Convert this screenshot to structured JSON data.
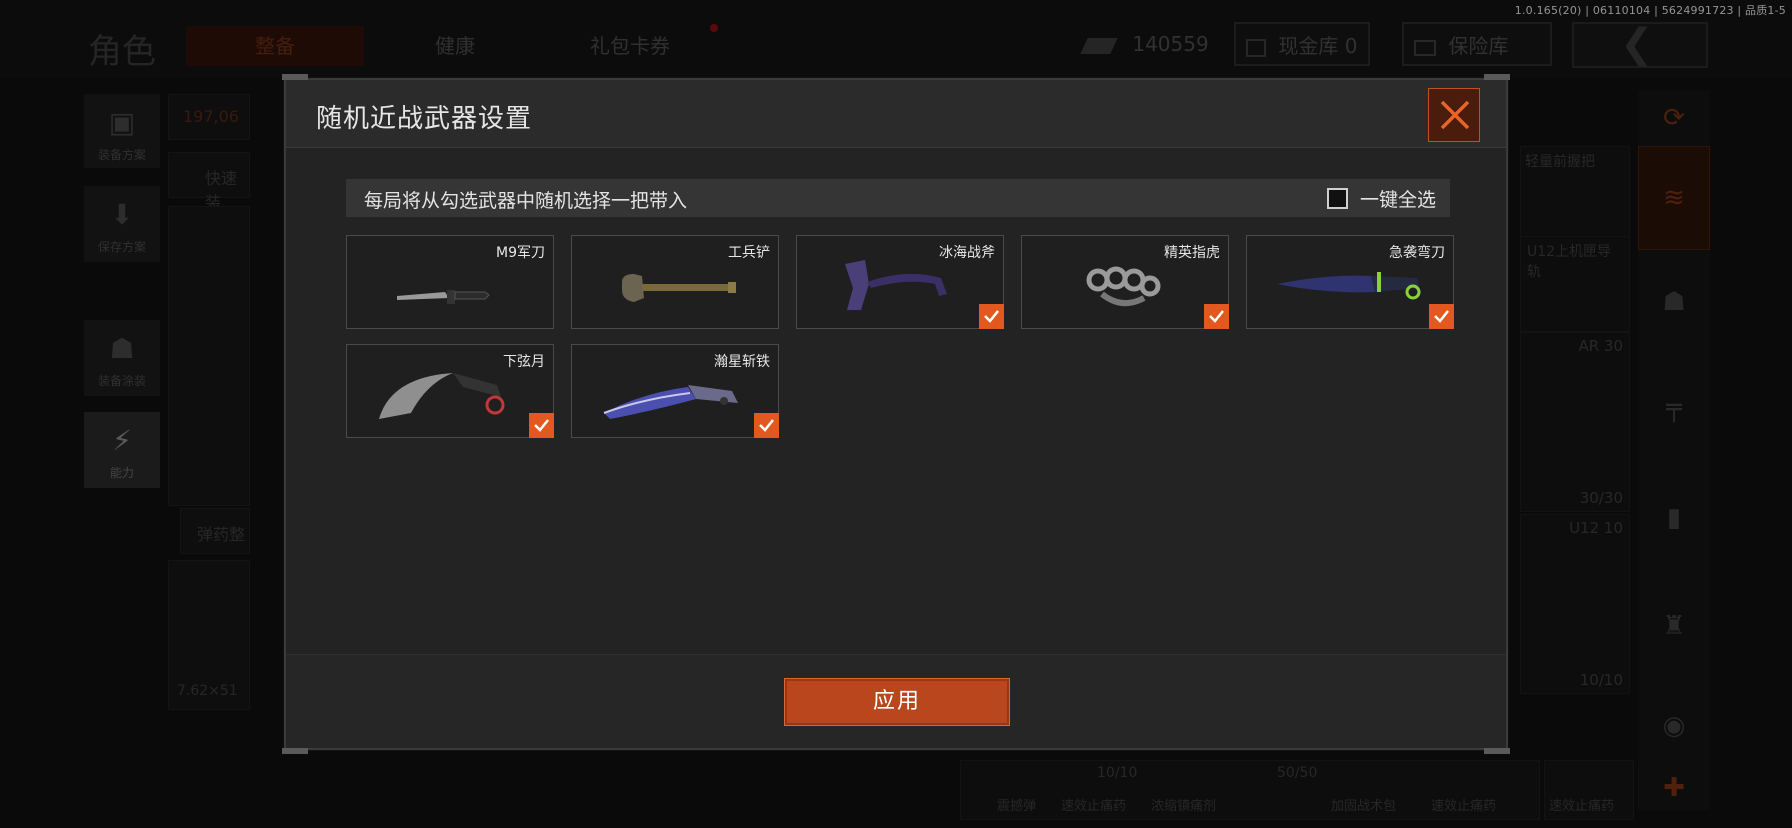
{
  "version_info": "1.0.165(20) | 06110104 | 5624991723 | 品质1-5",
  "background": {
    "page_title": "角色",
    "tabs": [
      {
        "label": "整备",
        "active": true
      },
      {
        "label": "健康",
        "active": false
      },
      {
        "label": "礼包卡券",
        "active": false
      }
    ],
    "currency_amount": "140559",
    "cash_vault_label": "现金库 0",
    "insurance_label": "保险库",
    "side_menu": [
      {
        "label": "装备方案"
      },
      {
        "label": "保存方案"
      },
      {
        "label": "装备涂装"
      },
      {
        "label": "能力"
      }
    ],
    "value_readout": "197,06",
    "quick_label": "快速装",
    "ammo_label": "弹药整",
    "caliber": "7.62×51",
    "right_slots": [
      {
        "label": "轻量前握把"
      },
      {
        "label": "U12上机匣导轨"
      },
      {
        "label": "AR 30",
        "count": "30/30"
      },
      {
        "label": "U12 10",
        "count": "10/10"
      }
    ],
    "bottom_counts": [
      "10/10",
      "50/50"
    ],
    "bottom_items": [
      "震撼弹",
      "速效止痛药",
      "浓缩镇痛剂",
      "加固战术包",
      "速效止痛药",
      "速效止痛药"
    ]
  },
  "modal": {
    "title": "随机近战武器设置",
    "info_text": "每局将从勾选武器中随机选择一把带入",
    "select_all_label": "一键全选",
    "apply_label": "应用",
    "accent_color": "#e2581f",
    "weapons": [
      {
        "name": "M9军刀",
        "checked": false,
        "icon": "bayonet-icon"
      },
      {
        "name": "工兵铲",
        "checked": false,
        "icon": "shovel-icon"
      },
      {
        "name": "冰海战斧",
        "checked": true,
        "icon": "axe-icon"
      },
      {
        "name": "精英指虎",
        "checked": true,
        "icon": "knuckles-icon"
      },
      {
        "name": "急袭弯刀",
        "checked": true,
        "icon": "machete-icon"
      },
      {
        "name": "下弦月",
        "checked": true,
        "icon": "karambit-icon"
      },
      {
        "name": "瀚星斩铁",
        "checked": true,
        "icon": "cleaver-icon"
      }
    ]
  }
}
